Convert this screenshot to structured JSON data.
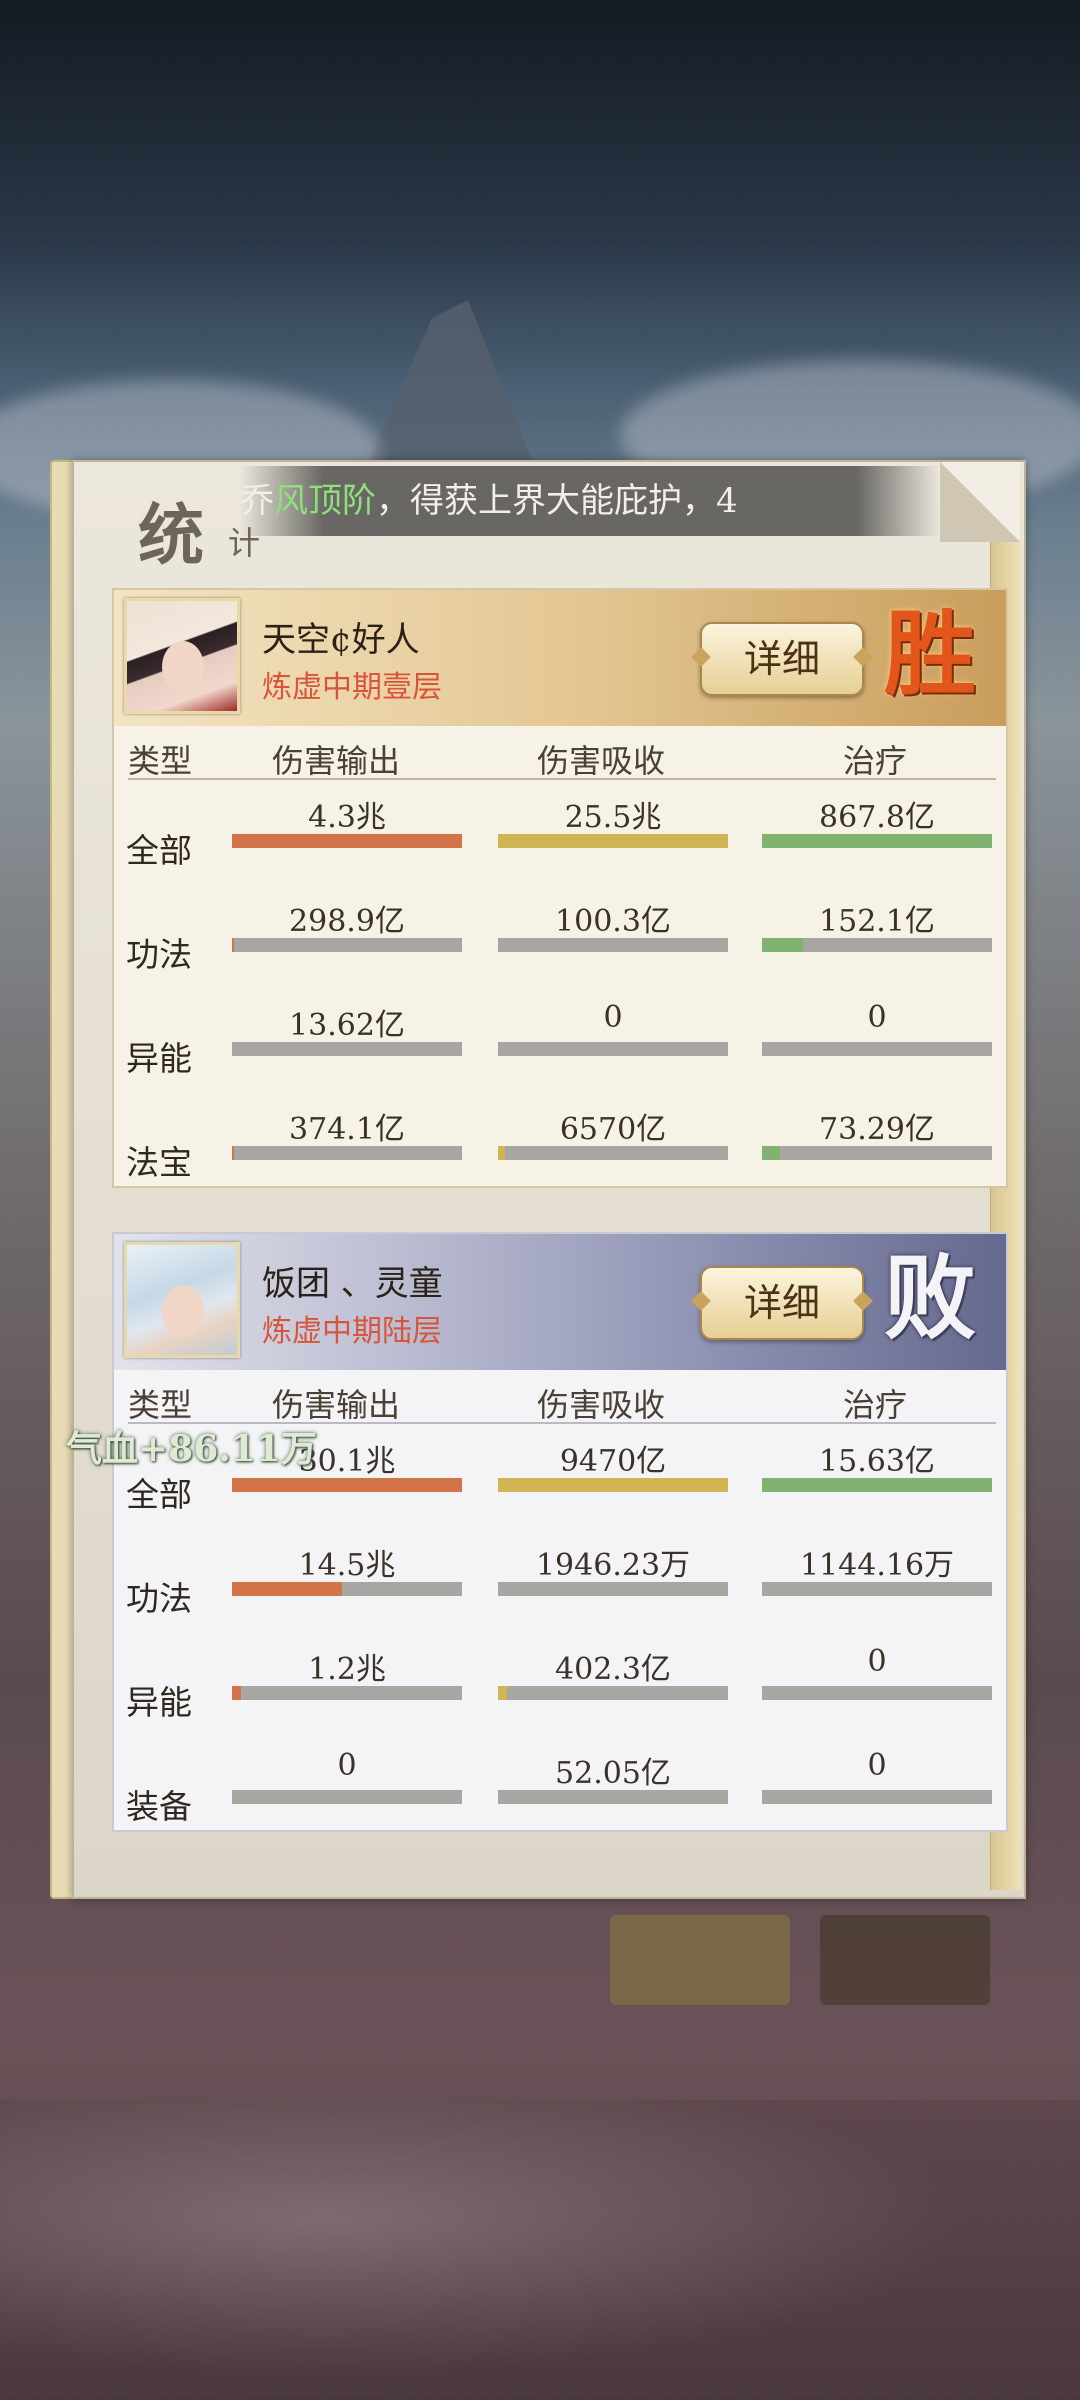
{
  "colors": {
    "damage": "#d2734a",
    "absorb": "#d1b454",
    "heal": "#7fb36f",
    "win": "#e2561c"
  },
  "title": {
    "main": "统",
    "sub": "计"
  },
  "marquee": {
    "prefix": "乔",
    "highlight": "风顶阶",
    "rest": "，得获上界大能庇护，4"
  },
  "headers": {
    "type": "类型",
    "damage": "伤害输出",
    "absorb": "伤害吸收",
    "heal": "治疗"
  },
  "detail_label": "详细",
  "float_text": "气血+86.11万",
  "players": [
    {
      "name": "天空¢好人",
      "rank": "炼虚中期壹层",
      "result": "胜",
      "rows": [
        {
          "label": "全部",
          "damage": "4.3兆",
          "damage_pct": 1.0,
          "absorb": "25.5兆",
          "absorb_pct": 1.0,
          "heal": "867.8亿",
          "heal_pct": 1.0
        },
        {
          "label": "功法",
          "damage": "298.9亿",
          "damage_pct": 0.01,
          "absorb": "100.3亿",
          "absorb_pct": 0.0,
          "heal": "152.1亿",
          "heal_pct": 0.18
        },
        {
          "label": "异能",
          "damage": "13.62亿",
          "damage_pct": 0.0,
          "absorb": "0",
          "absorb_pct": 0.0,
          "heal": "0",
          "heal_pct": 0.0
        },
        {
          "label": "法宝",
          "damage": "374.1亿",
          "damage_pct": 0.01,
          "absorb": "6570亿",
          "absorb_pct": 0.03,
          "heal": "73.29亿",
          "heal_pct": 0.08
        }
      ]
    },
    {
      "name": "饭团 、灵童",
      "rank": "炼虚中期陆层",
      "result": "败",
      "rows": [
        {
          "label": "全部",
          "damage": "30.1兆",
          "damage_pct": 1.0,
          "absorb": "9470亿",
          "absorb_pct": 1.0,
          "heal": "15.63亿",
          "heal_pct": 1.0
        },
        {
          "label": "功法",
          "damage": "14.5兆",
          "damage_pct": 0.48,
          "absorb": "1946.23万",
          "absorb_pct": 0.0,
          "heal": "1144.16万",
          "heal_pct": 0.0
        },
        {
          "label": "异能",
          "damage": "1.2兆",
          "damage_pct": 0.04,
          "absorb": "402.3亿",
          "absorb_pct": 0.04,
          "heal": "0",
          "heal_pct": 0.0
        },
        {
          "label": "装备",
          "damage": "0",
          "damage_pct": 0.0,
          "absorb": "52.05亿",
          "absorb_pct": 0.0,
          "heal": "0",
          "heal_pct": 0.0
        }
      ]
    }
  ]
}
